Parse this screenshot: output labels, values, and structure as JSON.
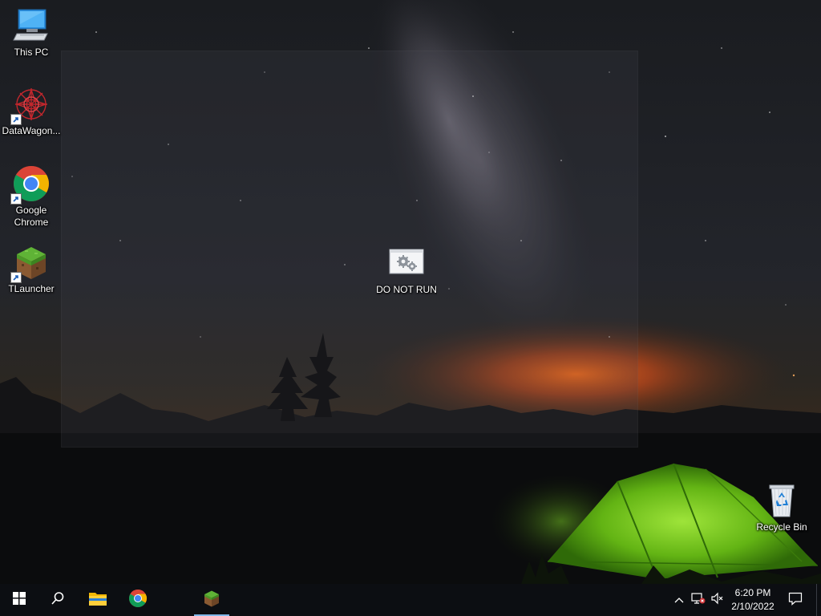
{
  "desktop": {
    "icons": [
      {
        "label": "This PC"
      },
      {
        "label": "DataWagon..."
      },
      {
        "label": "Google Chrome"
      },
      {
        "label": "TLauncher"
      },
      {
        "label": "DO NOT RUN"
      },
      {
        "label": "Recycle Bin"
      }
    ]
  },
  "taskbar": {
    "pinned": [
      "start-icon",
      "search-icon",
      "file-explorer-icon",
      "chrome-icon",
      "tlauncher-icon"
    ],
    "active_app": "tlauncher-icon",
    "clock": {
      "time": "6:20 PM",
      "date": "2/10/2022"
    },
    "tray": [
      "show-hidden-icons-icon",
      "network-disconnected-icon",
      "volume-muted-icon",
      "notifications-icon"
    ]
  },
  "colors": {
    "taskbar_bg": "#0c0e12",
    "active_indicator": "#7fb6e8",
    "tent_green": "#7ad12a"
  }
}
